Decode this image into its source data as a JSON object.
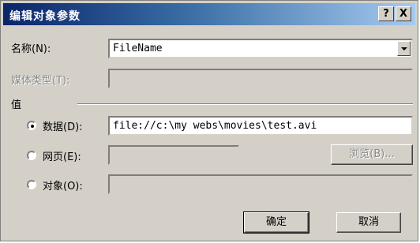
{
  "window": {
    "title": "编辑对象参数"
  },
  "title_buttons": {
    "help": "?",
    "close": "X"
  },
  "name": {
    "label": "名称(N):",
    "value": "FileName"
  },
  "media_type": {
    "label": "媒体类型(T):"
  },
  "value_group": {
    "label": "值"
  },
  "options": {
    "data": {
      "label": "数据(D):",
      "value": "file://c:\\my webs\\movies\\test.avi",
      "selected": true
    },
    "page": {
      "label": "网页(E):",
      "browse_label": "浏览(B)...",
      "selected": false
    },
    "object": {
      "label": "对象(O):",
      "selected": false
    }
  },
  "buttons": {
    "ok": "确定",
    "cancel": "取消"
  }
}
